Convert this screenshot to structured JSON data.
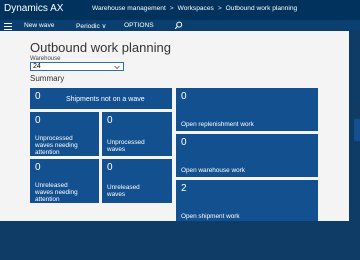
{
  "topbar": {
    "app_name": "Dynamics AX",
    "breadcrumbs": [
      "Warehouse management",
      "Workspaces",
      "Outbound work planning"
    ],
    "separator": ">"
  },
  "actionbar": {
    "new_wave": "New wave",
    "periodic": "Periodic ∨",
    "options": "OPTIONS"
  },
  "page": {
    "title": "Outbound work planning",
    "warehouse_label": "Warehouse",
    "warehouse_value": "24",
    "summary_label": "Summary",
    "right_edge_label": "S"
  },
  "tiles": {
    "shipments_not_on_wave": {
      "count": "0",
      "label": "Shipments not on a wave"
    },
    "unprocessed_waves_attention": {
      "count": "0",
      "label_lines": [
        "Unprocessed",
        "waves needing",
        "attention"
      ]
    },
    "unprocessed_waves": {
      "count": "0",
      "label_lines": [
        "Unprocessed",
        "waves"
      ]
    },
    "unreleased_waves_attention": {
      "count": "0",
      "label_lines": [
        "Unreleased",
        "waves needing",
        "attention"
      ]
    },
    "unreleased_waves": {
      "count": "0",
      "label_lines": [
        "Unreleased",
        "waves"
      ]
    },
    "open_replenishment_work": {
      "count": "0",
      "label": "Open replenishment work"
    },
    "open_warehouse_work": {
      "count": "0",
      "label": "Open warehouse work"
    },
    "open_shipment_work": {
      "count": "2",
      "label": "Open shipment work"
    }
  },
  "colors": {
    "topbar": "#00325e",
    "actionbar": "#0a3f70",
    "tile": "#13508f",
    "page_background": "#f4f4f4"
  }
}
